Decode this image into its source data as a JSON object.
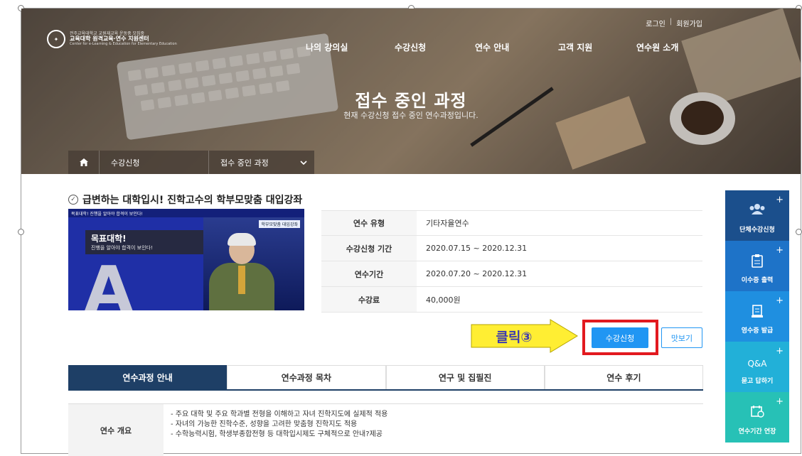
{
  "header": {
    "login": "로그인",
    "signup": "회원가입",
    "logo": {
      "line1": "전주교육대학교 교원재교육 운동중 모집중",
      "line2": "교육대학 원격교육·연수 지원센터",
      "line3": "Center for e-Learning & Education for Elementary Education"
    },
    "nav": [
      "나의 강의실",
      "수강신청",
      "연수 안내",
      "고객 지원",
      "연수원 소개"
    ]
  },
  "hero": {
    "title": "접수 중인 과정",
    "subtitle": "현재 수강신청 접수 중인 연수과정입니다."
  },
  "breadcrumb": {
    "level1": "수강신청",
    "level2": "접수 중인 과정"
  },
  "course": {
    "title": "급변하는 대학입시! 진학고수의 학부모맞춤 대입강좌",
    "thumbnail": {
      "top_caption": "목표대학! 진행을 알아야 합격이 보인다!",
      "caption1": "목표대학!",
      "caption2": "진행을 알아야 합격이 보인다!",
      "tag": "학부모맞춤 대입강좌",
      "letter": "A"
    },
    "info": [
      {
        "label": "연수 유형",
        "value": "기타자율연수"
      },
      {
        "label": "수강신청 기간",
        "value": "2020.07.15 ~ 2020.12.31"
      },
      {
        "label": "연수기간",
        "value": "2020.07.20 ~ 2020.12.31"
      },
      {
        "label": "수강료",
        "value": "40,000원"
      }
    ]
  },
  "annotation": {
    "label": "클릭③"
  },
  "actions": {
    "apply": "수강신청",
    "like": "맛보기"
  },
  "tabs": [
    "연수과정 안내",
    "연수과정 목차",
    "연구 및 집필진",
    "연수 후기"
  ],
  "overview": {
    "label": "연수 개요",
    "lines": [
      "- 주요 대학 및 주요 학과별 전형을 이해하고 자녀 진학지도에 실제적 적용",
      "- 자녀의 가능한 진학수준, 성향을 고려한 맞춤형 진학지도 적용",
      "- 수학능력시험, 학생부종합전형 등 대학입시제도 구체적으로 안내?제공"
    ]
  },
  "quick_menu": [
    {
      "label": "단체수강신청",
      "icon": "group-icon"
    },
    {
      "label": "이수증 출력",
      "icon": "clipboard-icon"
    },
    {
      "label": "영수증 발급",
      "icon": "receipt-icon"
    },
    {
      "label": "묻고 답하기",
      "icon": "qa-icon"
    },
    {
      "label": "연수기간 연장",
      "icon": "calendar-icon"
    }
  ],
  "quick_menu_qa_text": "Q&A",
  "colors": {
    "tab_active": "#1e3f66",
    "button_primary": "#2196f3",
    "highlight_frame": "#e2191f",
    "annotation_arrow": "#ffee33"
  }
}
